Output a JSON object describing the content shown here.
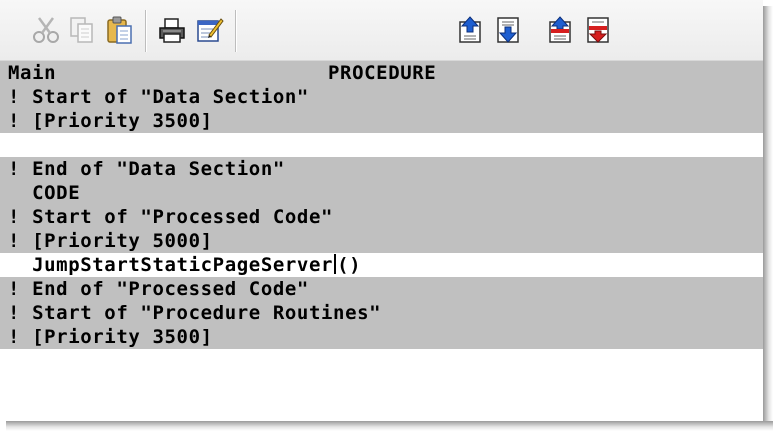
{
  "toolbar": {
    "buttons": [
      {
        "name": "cut",
        "icon": "scissors-icon",
        "enabled": false
      },
      {
        "name": "copy",
        "icon": "copy-icon",
        "enabled": false
      },
      {
        "name": "paste",
        "icon": "paste-icon",
        "enabled": true
      },
      {
        "name": "print",
        "icon": "printer-icon",
        "enabled": true
      },
      {
        "name": "edit",
        "icon": "edit-document-icon",
        "enabled": true
      },
      {
        "name": "embed-up",
        "icon": "embed-up-icon",
        "enabled": true
      },
      {
        "name": "embed-down",
        "icon": "embed-down-icon",
        "enabled": true
      },
      {
        "name": "embed-up-red",
        "icon": "embed-up-red-icon",
        "enabled": true
      },
      {
        "name": "embed-down-red",
        "icon": "embed-down-red-icon",
        "enabled": true
      }
    ]
  },
  "editor": {
    "lines": [
      {
        "left": "Main",
        "right": "PROCEDURE",
        "style": "gray"
      },
      {
        "text": "! Start of \"Data Section\"",
        "style": "gray"
      },
      {
        "text": "! [Priority 3500]",
        "style": "gray"
      },
      {
        "text": "",
        "style": "white"
      },
      {
        "text": "! End of \"Data Section\"",
        "style": "gray"
      },
      {
        "text": "  CODE",
        "style": "gray"
      },
      {
        "text": "! Start of \"Processed Code\"",
        "style": "gray"
      },
      {
        "text": "! [Priority 5000]",
        "style": "gray"
      },
      {
        "before_caret": "  JumpStartStaticPageServer",
        "after_caret": "()",
        "style": "white"
      },
      {
        "text": "! End of \"Processed Code\"",
        "style": "gray"
      },
      {
        "text": "! Start of \"Procedure Routines\"",
        "style": "gray"
      },
      {
        "text": "! [Priority 3500]",
        "style": "gray"
      },
      {
        "text": "",
        "style": "white"
      }
    ]
  },
  "colors": {
    "embedded_bg": "#c0c0c0",
    "editable_bg": "#ffffff",
    "arrow_blue": "#1f5fd0",
    "arrow_red": "#d61f1f"
  }
}
